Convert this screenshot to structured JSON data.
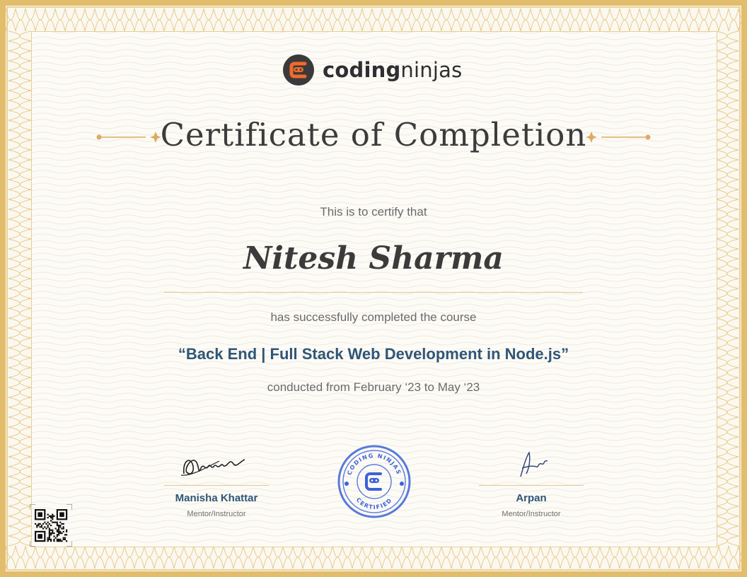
{
  "brand": {
    "logo_icon": "coding-ninjas-logo-icon",
    "name_bold": "coding",
    "name_light": "ninjas",
    "color": "#f26a2a"
  },
  "certificate": {
    "title": "Certificate of Completion",
    "certify_text": "This is to certify that",
    "recipient": "Nitesh Sharma",
    "completed_text": "has successfully completed the course",
    "course": "“Back End | Full Stack Web Development in Node.js”",
    "duration": "conducted from February ‘23 to May ‘23"
  },
  "signatories": [
    {
      "name": "Manisha Khattar",
      "role": "Mentor/Instructor"
    },
    {
      "name": "Arpan",
      "role": "Mentor/Instructor"
    }
  ],
  "stamp": {
    "top_text": "CODING NINJAS",
    "bottom_text": "CERTIFIED",
    "color": "#3b63d8"
  },
  "colors": {
    "border_gold": "#e2bd6c",
    "course_blue": "#2f5677",
    "text_gray": "#6b6b6b"
  },
  "qr_icon": "qr-code-icon"
}
